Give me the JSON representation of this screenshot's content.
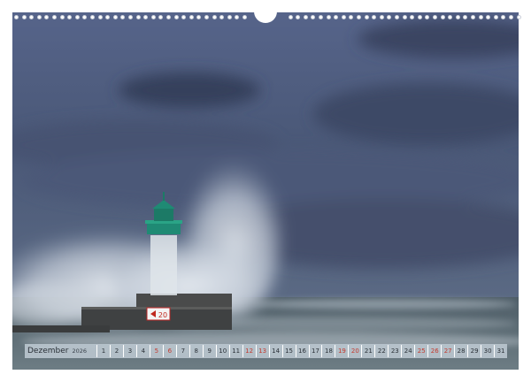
{
  "calendar": {
    "month": "Dezember",
    "year": "2026",
    "days": [
      {
        "num": "1",
        "weekend": false
      },
      {
        "num": "2",
        "weekend": false
      },
      {
        "num": "3",
        "weekend": false
      },
      {
        "num": "4",
        "weekend": false
      },
      {
        "num": "5",
        "weekend": true
      },
      {
        "num": "6",
        "weekend": true
      },
      {
        "num": "7",
        "weekend": false
      },
      {
        "num": "8",
        "weekend": false
      },
      {
        "num": "9",
        "weekend": false
      },
      {
        "num": "10",
        "weekend": false
      },
      {
        "num": "11",
        "weekend": false
      },
      {
        "num": "12",
        "weekend": true
      },
      {
        "num": "13",
        "weekend": true
      },
      {
        "num": "14",
        "weekend": false
      },
      {
        "num": "15",
        "weekend": false
      },
      {
        "num": "16",
        "weekend": false
      },
      {
        "num": "17",
        "weekend": false
      },
      {
        "num": "18",
        "weekend": false
      },
      {
        "num": "19",
        "weekend": true
      },
      {
        "num": "20",
        "weekend": true
      },
      {
        "num": "21",
        "weekend": false
      },
      {
        "num": "22",
        "weekend": false
      },
      {
        "num": "23",
        "weekend": false
      },
      {
        "num": "24",
        "weekend": false
      },
      {
        "num": "25",
        "weekend": true
      },
      {
        "num": "26",
        "weekend": true
      },
      {
        "num": "27",
        "weekend": true
      },
      {
        "num": "28",
        "weekend": false
      },
      {
        "num": "29",
        "weekend": false
      },
      {
        "num": "30",
        "weekend": false
      },
      {
        "num": "31",
        "weekend": false
      }
    ]
  },
  "photo": {
    "pier_sign": "20"
  },
  "colors": {
    "sky": "#4a5877",
    "sea": "#56646a",
    "lighthouse_top": "#1f8a74",
    "weekend": "#c43a2f"
  }
}
